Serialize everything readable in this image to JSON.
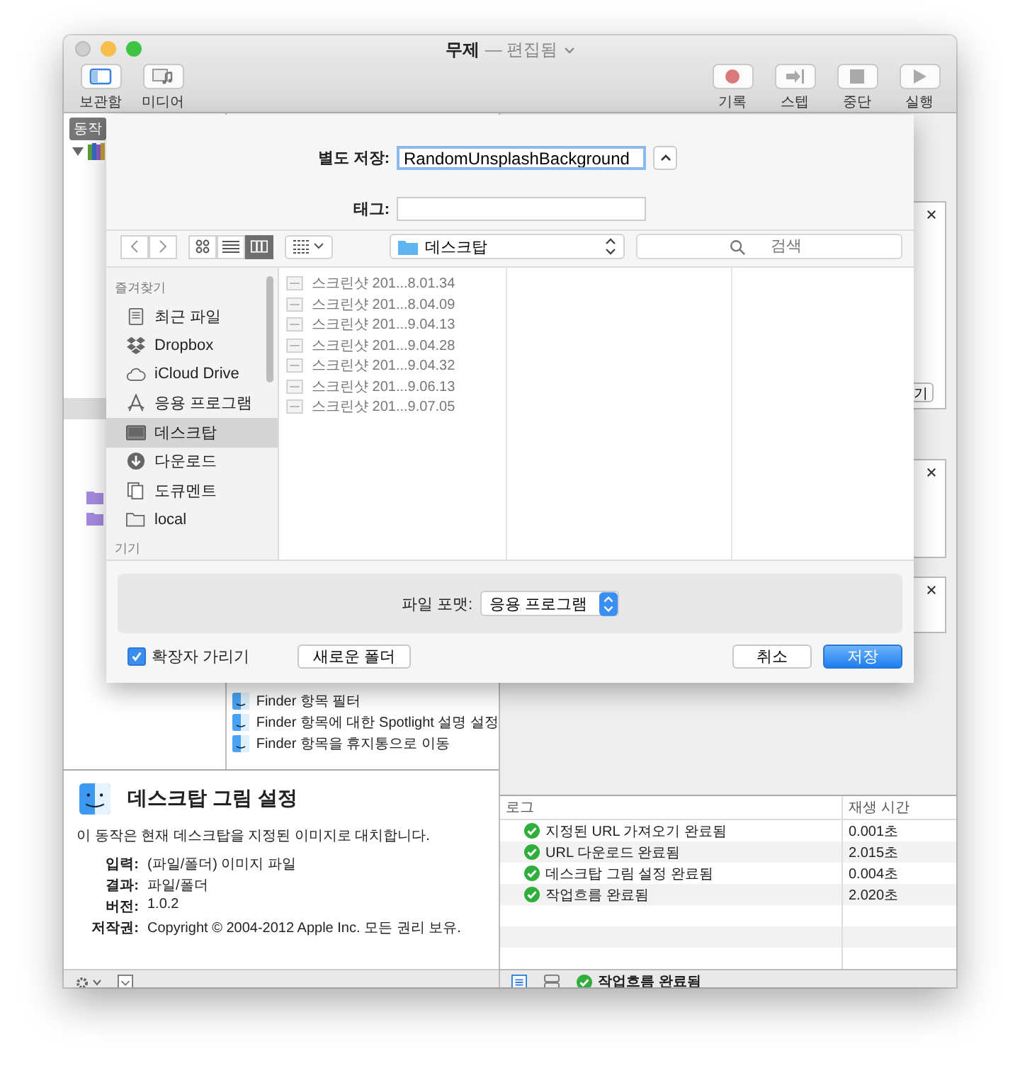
{
  "window": {
    "title": "무제",
    "subtitle": "— 편집됨"
  },
  "toolbar": {
    "left": [
      {
        "label": "보관함",
        "kind": "library"
      },
      {
        "label": "미디어",
        "kind": "media"
      }
    ],
    "right": [
      {
        "label": "기록",
        "kind": "record"
      },
      {
        "label": "스텝",
        "kind": "step"
      },
      {
        "label": "중단",
        "kind": "stop"
      },
      {
        "label": "실행",
        "kind": "run"
      }
    ]
  },
  "library": {
    "tab": "동작"
  },
  "actions_list": [
    "Finder 항목 필터",
    "Finder 항목에 대한 Spotlight 설명 설정",
    "Finder 항목을 휴지통으로 이동"
  ],
  "workflow": {
    "partial_button": "기"
  },
  "description": {
    "title": "데스크탑 그림 설정",
    "summary": "이 동작은 현재 데스크탑을 지정된 이미지로 대치합니다.",
    "fields": [
      {
        "label": "입력:",
        "value": "(파일/폴더) 이미지 파일"
      },
      {
        "label": "결과:",
        "value": "파일/폴더"
      },
      {
        "label": "버전:",
        "value": "1.0.2"
      },
      {
        "label": "저작권:",
        "value": "Copyright © 2004-2012 Apple Inc.  모든 권리 보유."
      }
    ]
  },
  "log": {
    "columns": [
      "로그",
      "재생 시간"
    ],
    "rows": [
      {
        "message": "지정된 URL 가져오기 완료됨",
        "duration": "0.001초"
      },
      {
        "message": "URL 다운로드 완료됨",
        "duration": "2.015초"
      },
      {
        "message": "데스크탑 그림 설정 완료됨",
        "duration": "0.004초"
      },
      {
        "message": "작업흐름 완료됨",
        "duration": "2.020초"
      }
    ]
  },
  "status_bar": {
    "message": "작업흐름 완료됨"
  },
  "save_sheet": {
    "save_as_label": "별도 저장:",
    "filename": "RandomUnsplashBackground",
    "tags_label": "태그:",
    "view_modes": [
      {
        "kind": "icon",
        "selected": false
      },
      {
        "kind": "list",
        "selected": false
      },
      {
        "kind": "column",
        "selected": true
      }
    ],
    "location": "데스크탑",
    "search_placeholder": "검색",
    "sidebar": [
      {
        "heading": "즐겨찾기",
        "items": [
          {
            "label": "최근 파일",
            "kind": "recents",
            "selected": false
          },
          {
            "label": "Dropbox",
            "kind": "dropbox",
            "selected": false
          },
          {
            "label": "iCloud Drive",
            "kind": "icloud",
            "selected": false
          },
          {
            "label": "응용 프로그램",
            "kind": "apps",
            "selected": false
          },
          {
            "label": "데스크탑",
            "kind": "desktop",
            "selected": true
          },
          {
            "label": "다운로드",
            "kind": "downloads",
            "selected": false
          },
          {
            "label": "도큐멘트",
            "kind": "documents",
            "selected": false
          },
          {
            "label": "local",
            "kind": "folder",
            "selected": false
          }
        ]
      },
      {
        "heading": "기기"
      }
    ],
    "files": [
      "스크린샷 201...8.01.34",
      "스크린샷 201...8.04.09",
      "스크린샷 201...9.04.13",
      "스크린샷 201...9.04.28",
      "스크린샷 201...9.04.32",
      "스크린샷 201...9.06.13",
      "스크린샷 201...9.07.05"
    ],
    "format_label": "파일 포맷:",
    "format": "응용 프로그램",
    "hide_extension": {
      "label": "확장자 가리기",
      "checked": true
    },
    "buttons": [
      {
        "label": "새로운 폴더",
        "kind": "secondary"
      },
      {
        "label": "취소",
        "kind": "normal"
      },
      {
        "label": "저장",
        "kind": "default"
      }
    ]
  }
}
